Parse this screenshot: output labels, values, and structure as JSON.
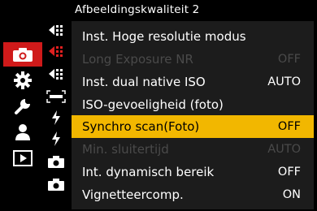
{
  "header": {
    "title": "Afbeeldingskwaliteit 2"
  },
  "sidebar": {
    "items": [
      {
        "icon": "camera-photo-icon",
        "active": true
      },
      {
        "icon": "gear-icon",
        "active": false
      },
      {
        "icon": "wrench-icon",
        "active": false
      },
      {
        "icon": "person-icon",
        "active": false
      },
      {
        "icon": "playback-icon",
        "active": false
      }
    ]
  },
  "subtabs": [
    {
      "icon": "image-quality-1-icon",
      "active": false
    },
    {
      "icon": "image-quality-2-icon",
      "active": true
    },
    {
      "icon": "image-quality-3-icon",
      "active": false
    },
    {
      "icon": "focus-icon",
      "active": false
    },
    {
      "icon": "flash-1-icon",
      "active": false
    },
    {
      "icon": "flash-2-icon",
      "active": false
    },
    {
      "icon": "camera-tab-1-icon",
      "active": false
    },
    {
      "icon": "camera-tab-2-icon",
      "active": false
    }
  ],
  "menu": {
    "items": [
      {
        "label": "Inst. Hoge resolutie modus",
        "value": "",
        "state": "normal"
      },
      {
        "label": "Long Exposure NR",
        "value": "OFF",
        "state": "disabled"
      },
      {
        "label": "Inst. dual native ISO",
        "value": "AUTO",
        "state": "normal"
      },
      {
        "label": "ISO-gevoeligheid (foto)",
        "value": "",
        "state": "normal"
      },
      {
        "label": "Synchro scan(Foto)",
        "value": "OFF",
        "state": "selected"
      },
      {
        "label": "Min. sluitertijd",
        "value": "AUTO",
        "state": "disabled"
      },
      {
        "label": "Int. dynamisch bereik",
        "value": "OFF",
        "state": "normal"
      },
      {
        "label": "Vignetteercomp.",
        "value": "ON",
        "state": "normal"
      }
    ]
  },
  "colors": {
    "accent_active_tab": "#cf1a1a",
    "selection_highlight": "#f2b700",
    "panel_background": "#1c1c1c",
    "disabled_text": "#4a4a4a"
  }
}
